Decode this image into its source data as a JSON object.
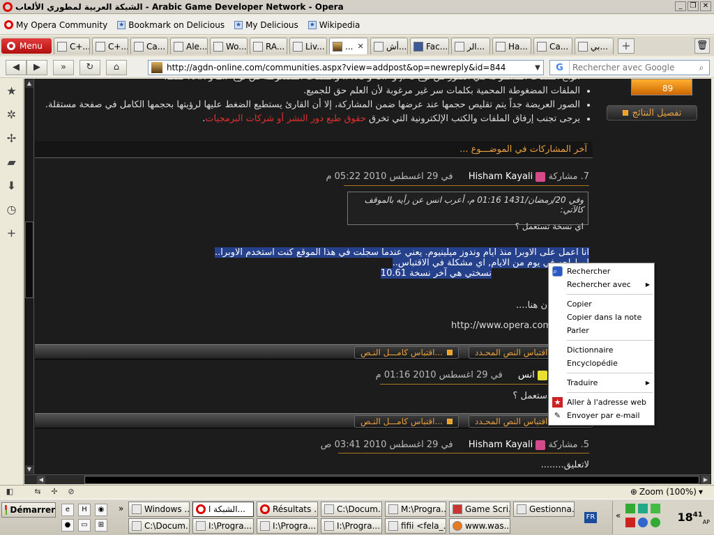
{
  "window": {
    "title": "الشبكة العربية لمطوري الألعاب - Arabic Game Developer Network - Opera",
    "buttons": [
      "_",
      "❐",
      "✕"
    ]
  },
  "bookmarks": [
    {
      "label": "My Opera Community",
      "icon": "opera-icon"
    },
    {
      "label": "Bookmark on Delicious",
      "icon": "bookmark-icon"
    },
    {
      "label": "My Delicious",
      "icon": "bookmark-icon"
    },
    {
      "label": "Wikipedia",
      "icon": "bookmark-icon"
    }
  ],
  "menu_label": "Menu",
  "tabs": [
    {
      "label": "C+..."
    },
    {
      "label": "C+..."
    },
    {
      "label": "Ca..."
    },
    {
      "label": "Ale..."
    },
    {
      "label": "Wo..."
    },
    {
      "label": "RA..."
    },
    {
      "label": "Liv..."
    },
    {
      "label": "...",
      "active": true
    },
    {
      "label": "أش..."
    },
    {
      "label": "Fac..."
    },
    {
      "label": "الر..."
    },
    {
      "label": "Ha..."
    },
    {
      "label": "Ca..."
    },
    {
      "label": "بي..."
    }
  ],
  "address": {
    "url": "http://agdn-online.com/communities.aspx?view=addpost&op=newreply&id=844"
  },
  "search": {
    "placeholder": "Rechercher avec Google"
  },
  "rules": [
    "الملفات المضغوطة المحمية بكلمات سر غير مرغوبة لأن العلم حق للجميع.",
    "الصور العريضة جداً يتم تقليص حجمها عند عرضها ضمن المشاركة، إلا أن القارئ يستطيع الضغط عليها لرؤيتها بحجمها الكامل في صفحة مستقلة.",
    "يرجى تجنب إرفاق الملفات والكتب الإلكترونية التي تخرق"
  ],
  "rules_link": "حقوق طبع دور النشر أو شركات البرمجيات",
  "rules_top_partial": "أنواع الملفات المسموحة هي الصور من نوع JPG و GIF و PNG، والملفات المضغوطة من نوع ZIP و RAR فقط.",
  "score": "89",
  "details_button": "تفصيل النتائج",
  "section_title": "آخر المشاركات في الموضـــوع ...",
  "posts": [
    {
      "number": "7. مشاركة",
      "author": "Hisham Kayali",
      "date": "في 29 اغسطس 2010 05:22 م",
      "quote_header": "وفي 20/رمضان/1431 01:16 م، أعرب انس عن رأيه بالموقف كالآتي:",
      "quote_body": "اي نسخة تستعمل ؟",
      "lines": [
        "انا اعمل على الاوبرا منذ ايام وندوز ميلينيوم.  يعني عندما سجلت في هذا الموقع كنت استخدم الاوبرا..",
        "لم اواجه في يوم من الايام, اي مشكلة في الاقتباس..",
        "نسختي هي آخر نسخة   10.61"
      ],
      "download_text": "ن هنا....",
      "link": "http://www.opera.com/"
    },
    {
      "number": "",
      "author": "انس",
      "date": "في 29 اغسطس 2010 01:16 م",
      "body": "ستعمل ؟"
    },
    {
      "number": "5. مشاركة",
      "author": "Hisham Kayali",
      "date": "في 29 اغسطس 2010 03:41 ص",
      "body": "لاتعليق........"
    }
  ],
  "quote_full": "اقتباس كامـــل النـص...",
  "quote_sel": "اقتباس النص المحـدد...",
  "context_menu": [
    {
      "label": "Rechercher",
      "icon": "search-icon"
    },
    {
      "label": "Rechercher avec",
      "submenu": true
    },
    {
      "sep": true
    },
    {
      "label": "Copier"
    },
    {
      "label": "Copier dans la note"
    },
    {
      "label": "Parler"
    },
    {
      "sep": true
    },
    {
      "label": "Dictionnaire"
    },
    {
      "label": "Encyclopédie"
    },
    {
      "sep": true
    },
    {
      "label": "Traduire",
      "submenu": true
    },
    {
      "sep": true
    },
    {
      "label": "Aller à l'adresse web",
      "icon": "bookmark-star-icon"
    },
    {
      "label": "Envoyer par e-mail",
      "icon": "pen-icon"
    }
  ],
  "status": {
    "zoom": "Zoom (100%)"
  },
  "taskbar": {
    "start": "Démarrer",
    "tasks_row1": [
      "Windows ...",
      "الشبكة ا...",
      "Résultats ...",
      "C:\\Docum...",
      "M:\\Progra...",
      "Game Scri...",
      "Gestionna..."
    ],
    "tasks_row2": [
      "C:\\Docum...",
      "I:\\Progra...",
      "I:\\Progra...",
      "I:\\Progra...",
      "fifii <fela_...",
      "www.was..."
    ],
    "lang": "FR",
    "clock_hour": "18",
    "clock_min": "41",
    "clock_suffix": "AP"
  }
}
